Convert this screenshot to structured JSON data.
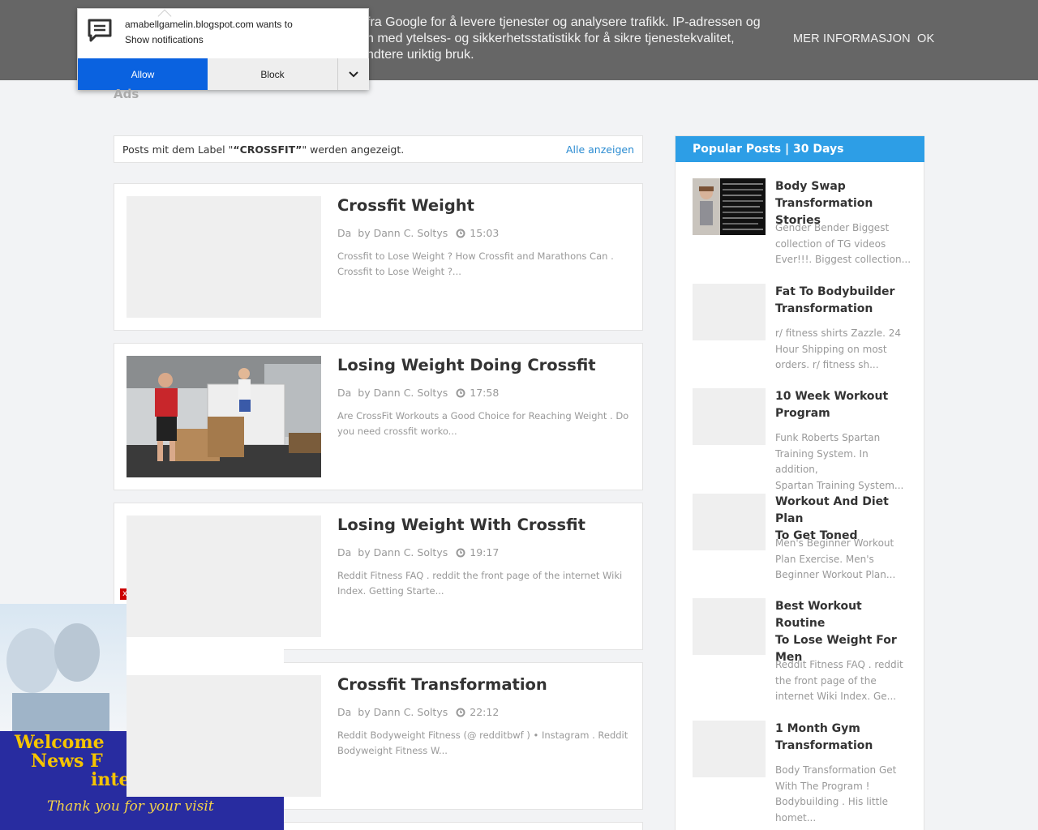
{
  "cookie_banner": {
    "text_lines": [
      "fra Google for å levere tjenester og analysere trafikk. IP-adressen og",
      "n med ytelses- og sikkerhetsstatistikk for å sikre tjenestekvalitet,",
      "ndtere uriktig bruk."
    ],
    "more_info": "MER INFORMASJON",
    "ok": "OK"
  },
  "notification": {
    "line1": "amabellgamelin.blogspot.com wants to",
    "line2": "Show notifications",
    "allow": "Allow",
    "block": "Block"
  },
  "ads_label": "Ads",
  "label_header": {
    "prefix": "Posts mit dem Label \"",
    "label": "“CROSSFIT”",
    "suffix": "\" werden angezeigt.",
    "show_all": "Alle anzeigen"
  },
  "posts": [
    {
      "title": "Crossfit Weight",
      "prefix": "Da",
      "author": "by Dann C. Soltys",
      "time": "15:03",
      "snippet": "Crossfit to Lose Weight ? How Crossfit and Marathons Can . Crossfit to Lose Weight ?..."
    },
    {
      "title": "Losing Weight Doing Crossfit",
      "prefix": "Da",
      "author": "by Dann C. Soltys",
      "time": "17:58",
      "snippet": "Are CrossFit Workouts a Good Choice for Reaching Weight . Do you need crossfit worko..."
    },
    {
      "title": "Losing Weight With Crossfit",
      "prefix": "Da",
      "author": "by Dann C. Soltys",
      "time": "19:17",
      "snippet": "Reddit Fitness FAQ . reddit the front page of the internet Wiki Index. Getting Starte..."
    },
    {
      "title": "Crossfit Transformation",
      "prefix": "Da",
      "author": "by Dann C. Soltys",
      "time": "22:12",
      "snippet": "Reddit Bodyweight Fitness (@ redditbwf ) • Instagram . Reddit Bodyweight Fitness W..."
    }
  ],
  "sidebar": {
    "header": "Popular Posts | 30 Days",
    "items": [
      {
        "title_lines": [
          "Body Swap",
          "Transformation Stories"
        ],
        "snippet_lines": [
          "Gender Bender Biggest",
          "collection of TG videos",
          "Ever!!!. Biggest collection..."
        ]
      },
      {
        "title_lines": [
          "Fat To Bodybuilder",
          "Transformation"
        ],
        "snippet_lines": [
          "r/ fitness shirts Zazzle. 24",
          "Hour Shipping on most",
          "orders. r/ fitness sh..."
        ]
      },
      {
        "title_lines": [
          "10 Week Workout",
          "Program"
        ],
        "snippet_lines": [
          "Funk Roberts Spartan",
          "Training System. In addition,",
          "Spartan Training System..."
        ]
      },
      {
        "title_lines": [
          "Workout And Diet Plan",
          "To Get Toned"
        ],
        "snippet_lines": [
          "Men's Beginner Workout",
          "Plan Exercise. Men's",
          "Beginner Workout Plan..."
        ]
      },
      {
        "title_lines": [
          "Best Workout Routine",
          "To Lose Weight For",
          "Men"
        ],
        "snippet_lines": [
          "Reddit Fitness FAQ . reddit",
          "the front page of the",
          "internet Wiki Index. Ge..."
        ]
      },
      {
        "title_lines": [
          "1 Month Gym",
          "Transformation"
        ],
        "snippet_lines": [
          "Body Transformation Get",
          "With The Program !",
          "Bodybuilding . His little",
          "homet..."
        ]
      }
    ]
  },
  "ad": {
    "line1": "Welcome",
    "line2": "News F",
    "line3": "inter",
    "thanks": "Thank you for your visit",
    "close": "x"
  },
  "colors": {
    "banner_bg": "#666666",
    "accent": "#2d9ee6",
    "allow_button": "#0a62e0",
    "ad_blue": "#282ca0",
    "ad_yellow": "#f5c400"
  }
}
